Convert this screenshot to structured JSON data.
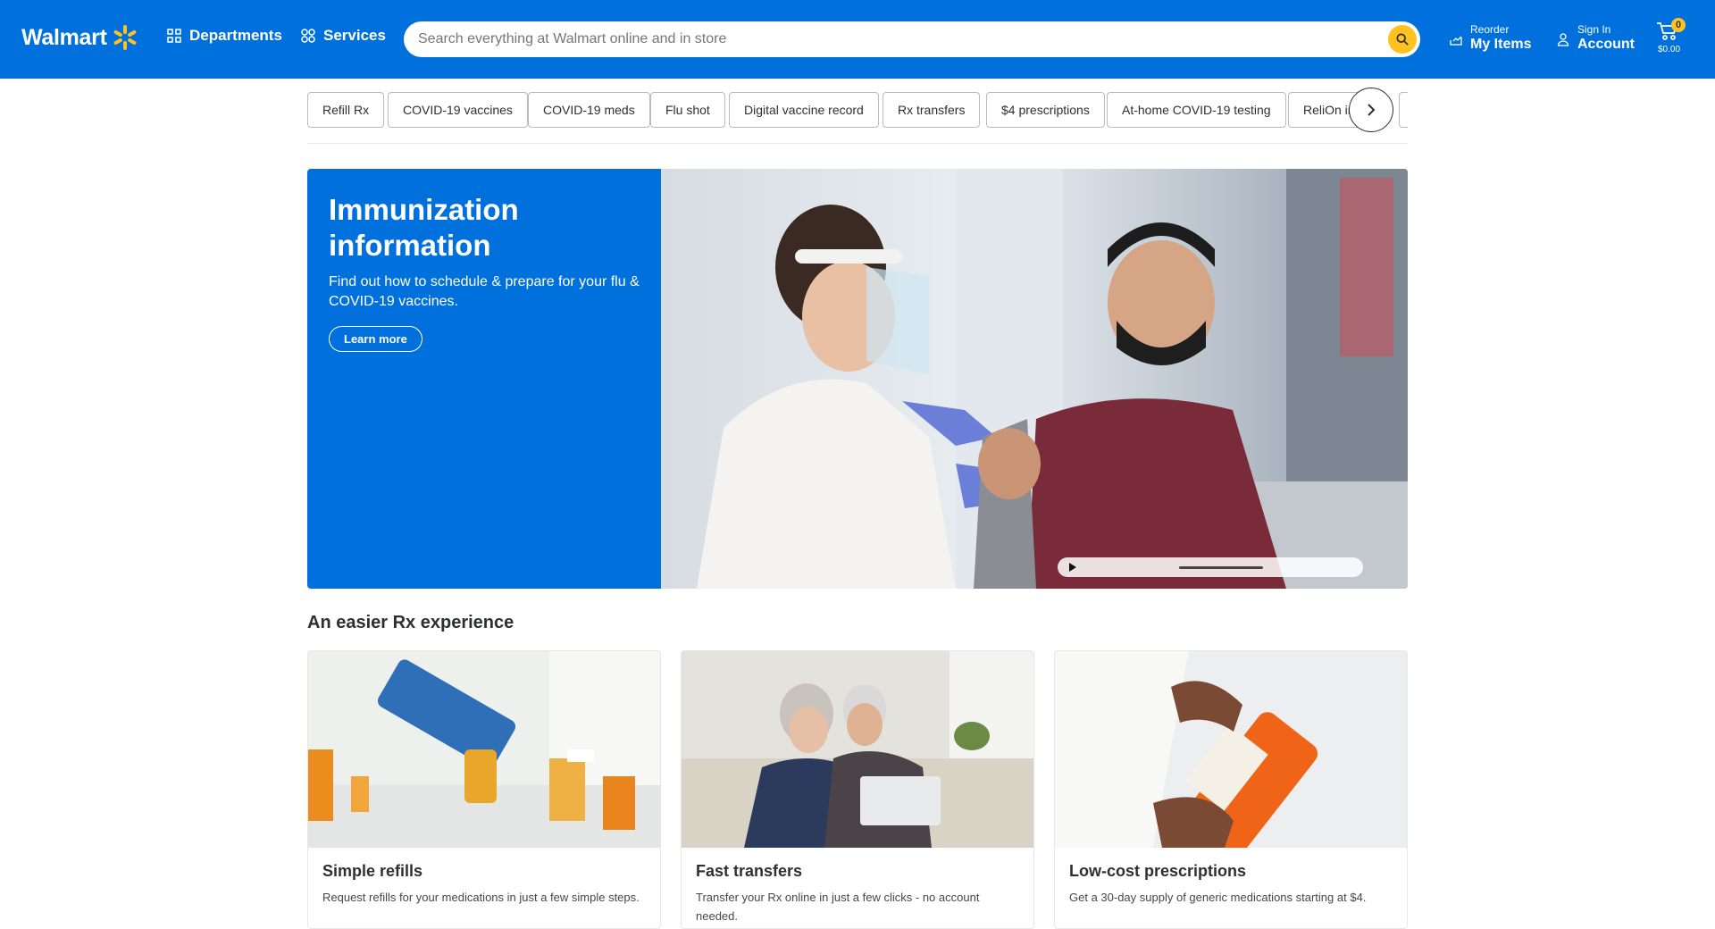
{
  "header": {
    "logo": "Walmart",
    "departments_label": "Departments",
    "services_label": "Services",
    "search_placeholder": "Search everything at Walmart online and in store",
    "reorder_small": "Reorder",
    "reorder_big": "My Items",
    "signin_small": "Sign In",
    "signin_big": "Account",
    "cart_count": "0",
    "cart_total": "$0.00",
    "brand_color": "#0071dc",
    "accent_color": "#ffc220"
  },
  "pills": [
    "Refill Rx",
    "COVID-19 vaccines",
    "COVID-19 meds",
    "Flu shot",
    "Digital vaccine record",
    "Rx transfers",
    "$4 prescriptions",
    "At-home COVID-19 testing",
    "ReliOn in"
  ],
  "hero": {
    "title": "Immunization information",
    "subtitle": "Find out how to schedule & prepare for your flu & COVID-19 vaccines.",
    "cta": "Learn more"
  },
  "section": {
    "title": "An easier Rx experience",
    "cards": [
      {
        "title": "Simple refills",
        "desc": "Request refills for your medications in just a few simple steps."
      },
      {
        "title": "Fast transfers",
        "desc": "Transfer your Rx online in just a few clicks - no account needed."
      },
      {
        "title": "Low-cost prescriptions",
        "desc": "Get a 30-day supply of generic medications starting at $4."
      }
    ]
  }
}
